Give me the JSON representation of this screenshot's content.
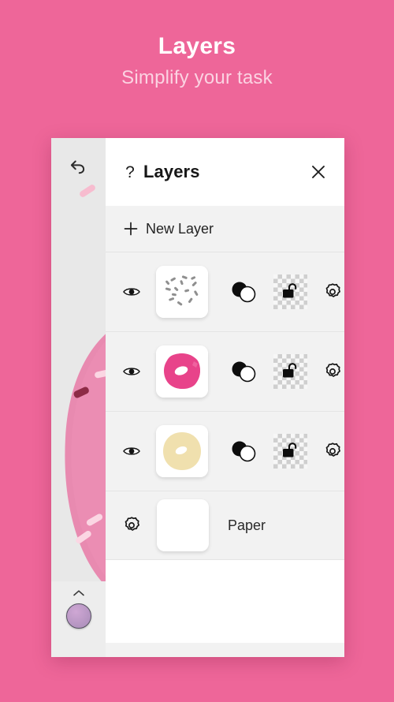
{
  "promo": {
    "title": "Layers",
    "subtitle": "Simplify your task"
  },
  "colors": {
    "background": "#ee6699",
    "panel": "#f2f2f2",
    "header": "#ffffff",
    "rail": "#e8e8e8",
    "text": "#161616",
    "subtitle": "#fbd3e2",
    "swatch": "#b394c0",
    "donut_pink": "#e8438a",
    "donut_cream": "#f0e0ae"
  },
  "rail": {
    "undo_icon": "undo-arrow-icon",
    "collapse_icon": "chevron-up-icon",
    "color_swatch_icon": "color-swatch-circle"
  },
  "panel": {
    "help_icon": "question-mark-icon",
    "title": "Layers",
    "close_icon": "close-x-icon",
    "new_layer": {
      "icon": "plus-icon",
      "label": "New Layer"
    },
    "row_icons": {
      "visibility": "eye-icon",
      "blend": "blend-circles-icon",
      "lock": "unlocked-padlock-icon",
      "settings": "gear-icon"
    },
    "layers": [
      {
        "thumbnail": "sprinkles-thumbnail",
        "visible": true,
        "locked": false
      },
      {
        "thumbnail": "pink-donut-thumbnail",
        "visible": true,
        "locked": false
      },
      {
        "thumbnail": "cream-donut-thumbnail",
        "visible": true,
        "locked": false
      }
    ],
    "paper": {
      "settings_icon": "gear-icon",
      "thumbnail": "white-paper-thumbnail",
      "label": "Paper"
    }
  }
}
